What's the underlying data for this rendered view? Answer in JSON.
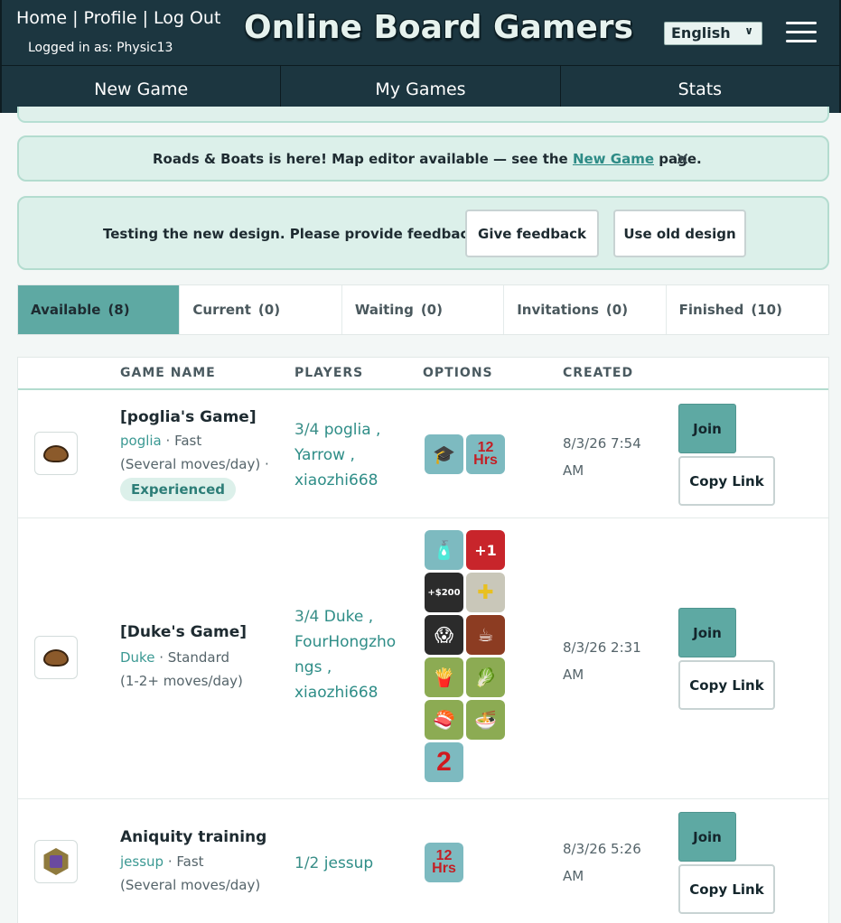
{
  "header": {
    "links": [
      "Home",
      "Profile",
      "Log Out"
    ],
    "logged_in": "Logged in as: Physic13",
    "brand": "Online Board Gamers",
    "language": "English"
  },
  "nav": [
    "New Game",
    "My Games",
    "Stats"
  ],
  "banners": {
    "roads": {
      "text_before": "Roads & Boats is here! Map editor available — see the ",
      "link": "New Game",
      "text_after": " page.",
      "close": "✕"
    },
    "design": {
      "text": "Testing the new design. Please provide feedback!",
      "feedback_button": "Give feedback",
      "old_design_button": "Use old design"
    }
  },
  "tabs": [
    {
      "label": "Available",
      "count": "(8)",
      "active": true
    },
    {
      "label": "Current",
      "count": "(0)"
    },
    {
      "label": "Waiting",
      "count": "(0)"
    },
    {
      "label": "Invitations",
      "count": "(0)"
    },
    {
      "label": "Finished",
      "count": "(10)"
    }
  ],
  "table": {
    "headers": [
      "GAME NAME",
      "PLAYERS",
      "OPTIONS",
      "CREATED"
    ],
    "join_label": "Join",
    "copy_label": "Copy Link",
    "rows": [
      {
        "name": "[poglia's Game]",
        "host": "poglia",
        "speed": "Fast",
        "pace": "(Several moves/day) ·",
        "badge": "Experienced",
        "players_count": "3/4",
        "players": [
          "poglia ,",
          "Yarrow ,",
          "xiaozhi668"
        ],
        "created_date": "8/3/26 7:54",
        "created_time": "AM"
      },
      {
        "name": "[Duke's Game]",
        "host": "Duke",
        "speed": "Standard",
        "pace": "(1-2+ moves/day)",
        "players_count": "3/4",
        "players": [
          "Duke ,",
          "FourHongzho",
          "ngs ,",
          "xiaozhi668"
        ],
        "created_date": "8/3/26 2:31",
        "created_time": "AM"
      },
      {
        "name": "Aniquity training",
        "host": "jessup",
        "speed": "Fast",
        "pace": "(Several moves/day)",
        "players_count": "1/2",
        "players": [
          "jessup"
        ],
        "created_date": "8/3/26 5:26",
        "created_time": "AM"
      }
    ],
    "option_labels": {
      "twelve_hrs_num": "12",
      "twelve_hrs_unit": "Hrs",
      "plus_one": "+1",
      "price": "+$200",
      "two": "2"
    }
  },
  "colors": {
    "header_bg": "#1c3640",
    "accent": "#5ea9a3",
    "banner_bg": "#dcf0ea",
    "link": "#2e8d87"
  }
}
